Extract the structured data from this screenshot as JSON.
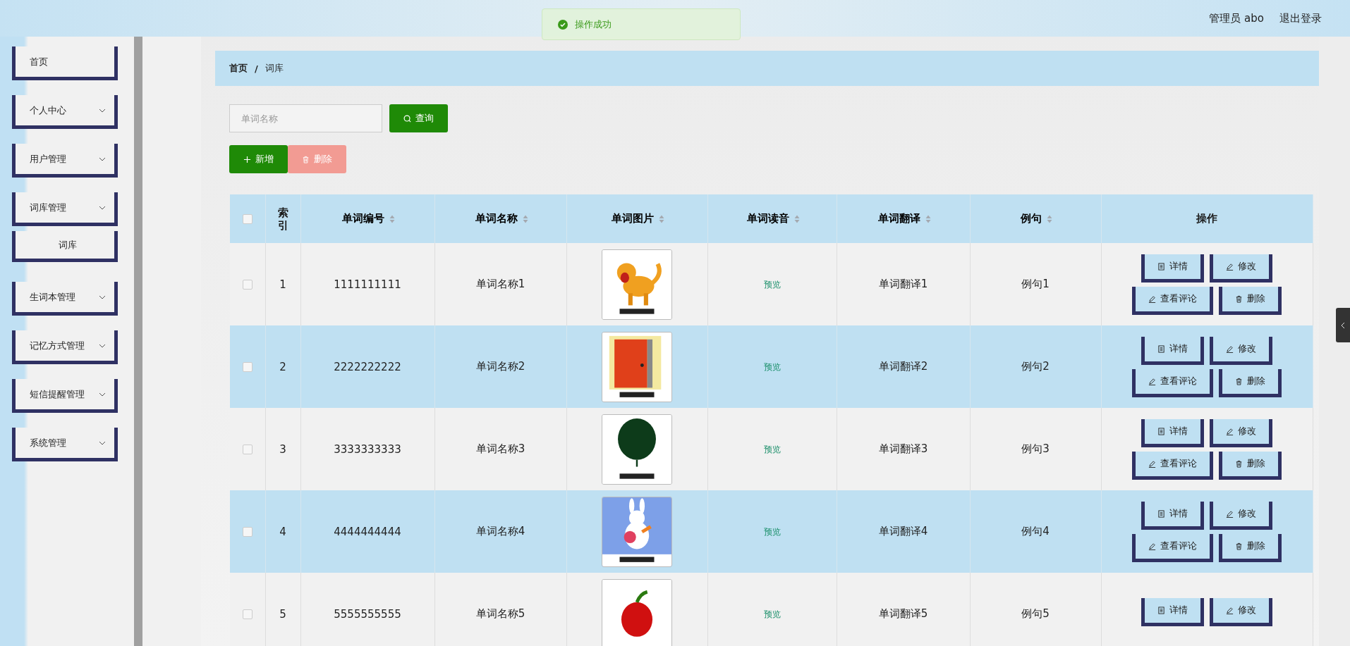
{
  "header": {
    "user": "管理员 abo",
    "logout": "退出登录"
  },
  "toast": {
    "message": "操作成功"
  },
  "sidebar": {
    "items": [
      {
        "label": "首页",
        "expandable": false
      },
      {
        "label": "个人中心",
        "expandable": true
      },
      {
        "label": "用户管理",
        "expandable": true
      },
      {
        "label": "词库管理",
        "expandable": true,
        "children": [
          {
            "label": "词库"
          }
        ]
      },
      {
        "label": "生词本管理",
        "expandable": true
      },
      {
        "label": "记忆方式管理",
        "expandable": true
      },
      {
        "label": "短信提醒管理",
        "expandable": true
      },
      {
        "label": "系统管理",
        "expandable": true
      }
    ]
  },
  "breadcrumb": [
    "首页",
    "词库"
  ],
  "breadcrumb_separator": "/",
  "search": {
    "placeholder": "单词名称",
    "button": "查询"
  },
  "toolbar": {
    "add": "新增",
    "delete": "删除",
    "delete_disabled": true
  },
  "table": {
    "select_all_checked": false,
    "columns": [
      {
        "label": "索引",
        "sortable": false
      },
      {
        "label": "单词编号",
        "sortable": true
      },
      {
        "label": "单词名称",
        "sortable": true
      },
      {
        "label": "单词图片",
        "sortable": true
      },
      {
        "label": "单词读音",
        "sortable": true
      },
      {
        "label": "单词翻译",
        "sortable": true
      },
      {
        "label": "例句",
        "sortable": true
      },
      {
        "label": "操作",
        "sortable": false
      }
    ],
    "rows": [
      {
        "index": "1",
        "id": "1111111111",
        "name": "单词名称1",
        "audio": "预览",
        "translation": "单词翻译1",
        "example": "例句1",
        "checked": false,
        "actions": [
          "详情",
          "修改",
          "查看评论",
          "删除"
        ]
      },
      {
        "index": "2",
        "id": "2222222222",
        "name": "单词名称2",
        "audio": "预览",
        "translation": "单词翻译2",
        "example": "例句2",
        "checked": false,
        "actions": [
          "详情",
          "修改",
          "查看评论",
          "删除"
        ]
      },
      {
        "index": "3",
        "id": "3333333333",
        "name": "单词名称3",
        "audio": "预览",
        "translation": "单词翻译3",
        "example": "例句3",
        "checked": false,
        "actions": [
          "详情",
          "修改",
          "查看评论",
          "删除"
        ]
      },
      {
        "index": "4",
        "id": "4444444444",
        "name": "单词名称4",
        "audio": "预览",
        "translation": "单词翻译4",
        "example": "例句4",
        "checked": false,
        "actions": [
          "详情",
          "修改",
          "查看评论",
          "删除"
        ]
      },
      {
        "index": "5",
        "id": "5555555555",
        "name": "单词名称5",
        "audio": "预览",
        "translation": "单词翻译5",
        "example": "例句5",
        "checked": false,
        "actions": [
          "详情",
          "修改"
        ]
      }
    ]
  }
}
